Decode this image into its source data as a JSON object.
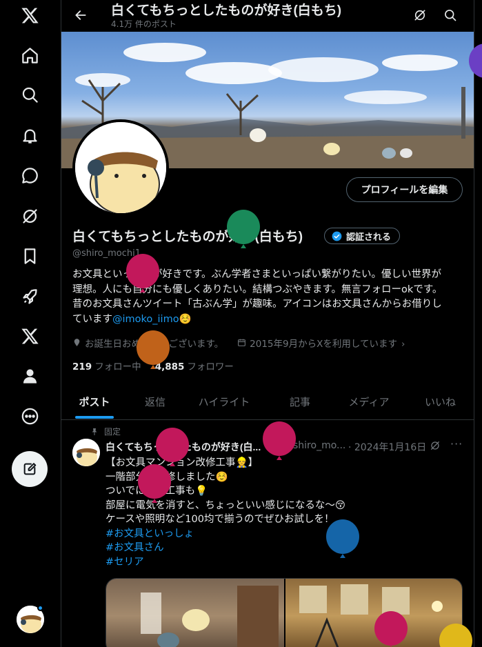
{
  "nav": {
    "items": [
      {
        "name": "x-logo"
      },
      {
        "name": "home"
      },
      {
        "name": "explore"
      },
      {
        "name": "notifications"
      },
      {
        "name": "messages"
      },
      {
        "name": "grok"
      },
      {
        "name": "bookmarks"
      },
      {
        "name": "jobs"
      },
      {
        "name": "premium"
      },
      {
        "name": "profile"
      },
      {
        "name": "more"
      }
    ]
  },
  "header": {
    "title": "白くてもちっとしたものが好き(白もち)",
    "post_count": "4.1万 件のポスト"
  },
  "profile": {
    "display_name": "白くてもちっとしたものが好き(白もち)",
    "verify_label": "認証される",
    "handle": "@shiro_mochi1",
    "edit_label": "プロフィールを編集",
    "bio_lines": [
      "お文具といっしょが好きです。ぶん学者さまといっぱい繋がりたい。優しい世界が",
      "理想。人にも自分にも優しくありたい。結構つぶやきます。無言フォローokです。",
      "昔のお文具さんツイート「古ぶん学」が趣味。アイコンはお文具さんからお借りし",
      "ています"
    ],
    "bio_link": "@imoko_iimo",
    "bio_emoji": "☺️",
    "birthday": "お誕生日おめでとうございます。",
    "joined": "2015年9月からXを利用しています",
    "following_count": "219",
    "following_label": "フォロー中",
    "followers_count": "4,885",
    "followers_label": "フォロワー"
  },
  "tabs": [
    {
      "label": "ポスト",
      "active": true
    },
    {
      "label": "返信"
    },
    {
      "label": "ハイライト"
    },
    {
      "label": "記事"
    },
    {
      "label": "メディア"
    },
    {
      "label": "いいね"
    }
  ],
  "post": {
    "pinned_label": "固定",
    "author": "白くてもちっとしたものが好き(白...",
    "handle": "@shiro_mo...",
    "date": "· 2024年1月16日",
    "lines": [
      "【お文具マンション改修工事👷】",
      "一階部分を改修しました☺️",
      "ついでに電気工事も💡",
      "部屋に電気を消すと、ちょっといい感じになるな〜😚",
      "ケースや照明など100均で揃うのでぜひお試しを！"
    ],
    "hashtags": [
      "#お文具といっしょ",
      "#お文具さん",
      "#セリア"
    ]
  },
  "colors": {
    "accent": "#1d9bf0",
    "background": "#000000",
    "text": "#e7e9ea",
    "muted": "#71767b",
    "balloons": [
      "#c2185b",
      "#1a8a5a",
      "#c0621a",
      "#1565a8",
      "#e0b81a",
      "#6b3fc4"
    ]
  }
}
